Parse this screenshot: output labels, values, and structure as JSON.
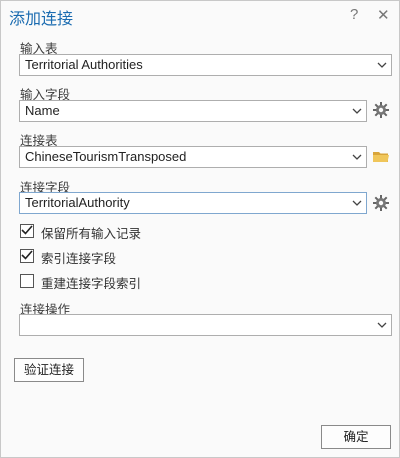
{
  "dialog": {
    "title": "添加连接",
    "help_glyph": "?",
    "close_glyph": "✕"
  },
  "input_table": {
    "label": "输入表",
    "value": "Territorial Authorities"
  },
  "input_field": {
    "label": "输入字段",
    "value": "Name",
    "side_icon": "gear-icon"
  },
  "join_table": {
    "label": "连接表",
    "value": "ChineseTourismTransposed",
    "side_icon": "folder-icon"
  },
  "join_field": {
    "label": "连接字段",
    "value": "TerritorialAuthority",
    "side_icon": "gear-icon"
  },
  "options": [
    {
      "label": "保留所有输入记录",
      "checked": true
    },
    {
      "label": "索引连接字段",
      "checked": true
    },
    {
      "label": "重建连接字段索引",
      "checked": false
    }
  ],
  "join_operation": {
    "label": "连接操作",
    "value": ""
  },
  "validate_button": "验证连接",
  "ok_button": "确定",
  "colors": {
    "title": "#1a6bb0",
    "folder": "#e6b84a",
    "border": "#aeaeae"
  }
}
